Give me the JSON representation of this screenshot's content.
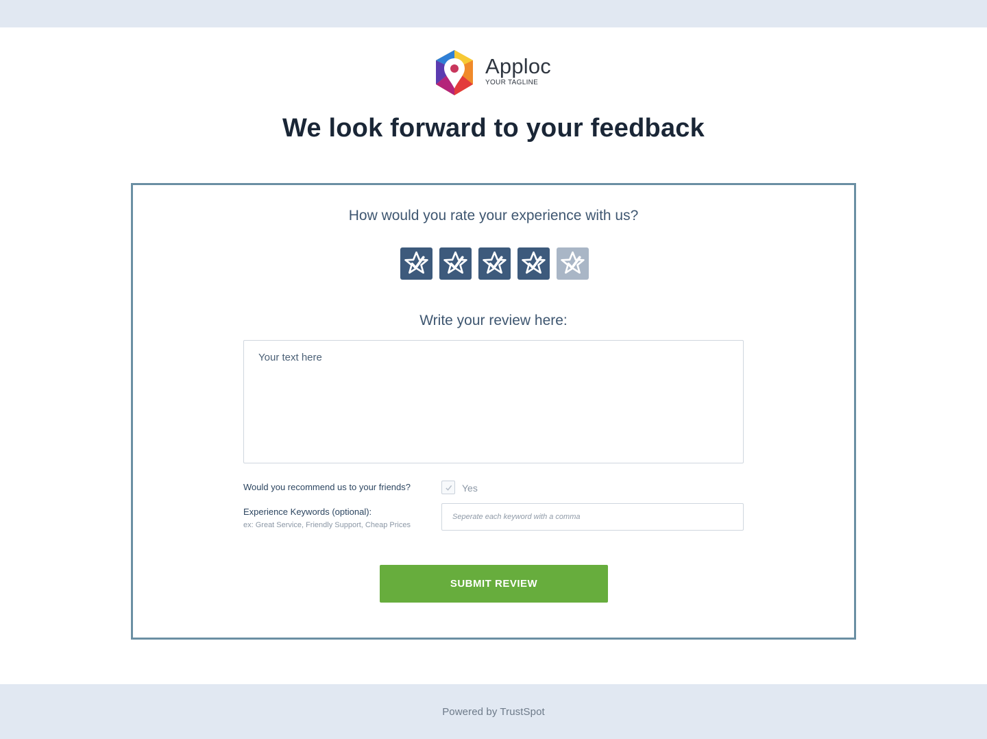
{
  "logo": {
    "name": "Apploc",
    "tagline": "YOUR TAGLINE"
  },
  "page_title": "We look forward to your feedback",
  "form": {
    "rate_question": "How would you rate your experience with us?",
    "rating": 4,
    "rating_max": 5,
    "review_heading": "Write your review here:",
    "review_placeholder": "Your text here",
    "recommend_label": "Would you recommend us to your friends?",
    "recommend_option": "Yes",
    "keywords_label": "Experience Keywords (optional):",
    "keywords_hint": "ex: Great Service, Friendly Support, Cheap Prices",
    "keywords_placeholder": "Seperate each keyword with a comma",
    "submit_label": "SUBMIT REVIEW"
  },
  "footer": {
    "text": "Powered by TrustSpot"
  },
  "colors": {
    "star_active": "#3d5a7c",
    "star_inactive": "#a9b6c6",
    "submit": "#67ad3d",
    "card_border": "#6a8fa3",
    "band": "#e1e8f2"
  },
  "icons": {
    "star": "star-check-icon",
    "logo": "hexagon-pin-logo",
    "check": "check-icon"
  }
}
